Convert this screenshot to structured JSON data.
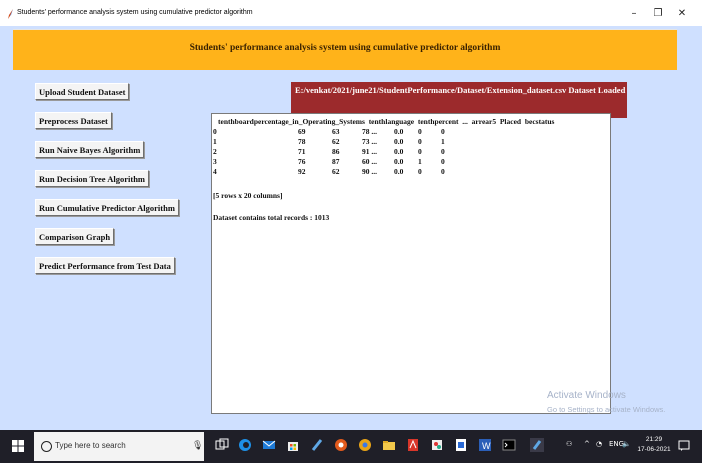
{
  "window": {
    "title": "Students' performance analysis system using cumulative predictor algorithm",
    "minimize_glyph": "–",
    "maximize_glyph": "❐",
    "close_glyph": "✕"
  },
  "header": {
    "title": "Students' performance analysis system using cumulative predictor algorithm"
  },
  "buttons": [
    "Upload Student Dataset",
    "Preprocess Dataset",
    "Run Naive Bayes Algorithm",
    "Run Decision Tree Algorithm",
    "Run Cumulative Predictor Algorithm",
    "Comparison Graph",
    "Predict Performance from Test Data"
  ],
  "status": {
    "loaded": "E:/venkat/2021/june21/StudentPerformance/Dataset/Extension_dataset.csv Dataset Loaded"
  },
  "output": {
    "header_line": "tenthboardpercentage_in_Operating_Systems  tenthlanguage  tenthpercent  ...  arrear5  Placed  becstatus",
    "rows": [
      {
        "idx": "0",
        "a": "69",
        "b": "63",
        "c": "78 ...",
        "d": "0.0",
        "e": "0",
        "f": "0"
      },
      {
        "idx": "1",
        "a": "78",
        "b": "62",
        "c": "73 ...",
        "d": "0.0",
        "e": "0",
        "f": "1"
      },
      {
        "idx": "2",
        "a": "71",
        "b": "86",
        "c": "91 ...",
        "d": "0.0",
        "e": "0",
        "f": "0"
      },
      {
        "idx": "3",
        "a": "76",
        "b": "87",
        "c": "60 ...",
        "d": "0.0",
        "e": "1",
        "f": "0"
      },
      {
        "idx": "4",
        "a": "92",
        "b": "62",
        "c": "90 ...",
        "d": "0.0",
        "e": "0",
        "f": "0"
      }
    ],
    "shape_note": "[5 rows x 20 columns]",
    "total_records": "Dataset contains total records : 1013"
  },
  "watermark": {
    "line1": "Activate Windows",
    "line2": "Go to Settings to activate Windows."
  },
  "taskbar": {
    "search_placeholder": "Type here to search",
    "time": "21:29",
    "date": "17-06-2021",
    "lang": "ENG",
    "accent": "#1f1f28"
  }
}
